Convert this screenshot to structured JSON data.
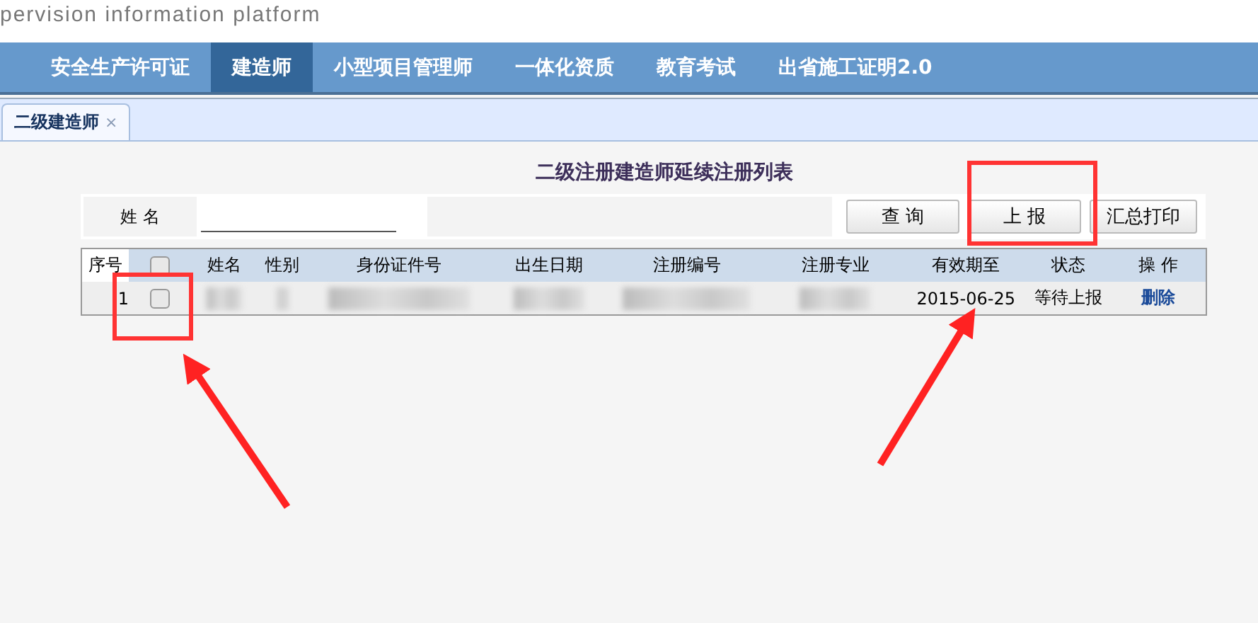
{
  "header": {
    "subtitle": "pervision information platform"
  },
  "nav": [
    {
      "label": "安全生产许可证",
      "selected": false
    },
    {
      "label": "建造师",
      "selected": true
    },
    {
      "label": "小型项目管理师",
      "selected": false
    },
    {
      "label": "一体化资质",
      "selected": false
    },
    {
      "label": "教育考试",
      "selected": false
    },
    {
      "label": "出省施工证明2.0",
      "selected": false
    }
  ],
  "tabs": [
    {
      "label": "二级建造师",
      "close": "×",
      "selected": true
    }
  ],
  "page_title": "二级注册建造师延续注册列表",
  "search": {
    "label": "姓 名",
    "buttons": [
      "查 询",
      "上 报",
      "汇总打印"
    ]
  },
  "table": {
    "columns": [
      "序号",
      "姓名",
      "性别",
      "身份证件号",
      "出生日期",
      "注册编号",
      "注册专业",
      "有效期至",
      "状态",
      "操 作"
    ],
    "header_checked": false,
    "rows": [
      {
        "index": "1",
        "checked": false,
        "expiry": "2015-06-25",
        "status": "等待上报",
        "action": "删除"
      }
    ]
  }
}
